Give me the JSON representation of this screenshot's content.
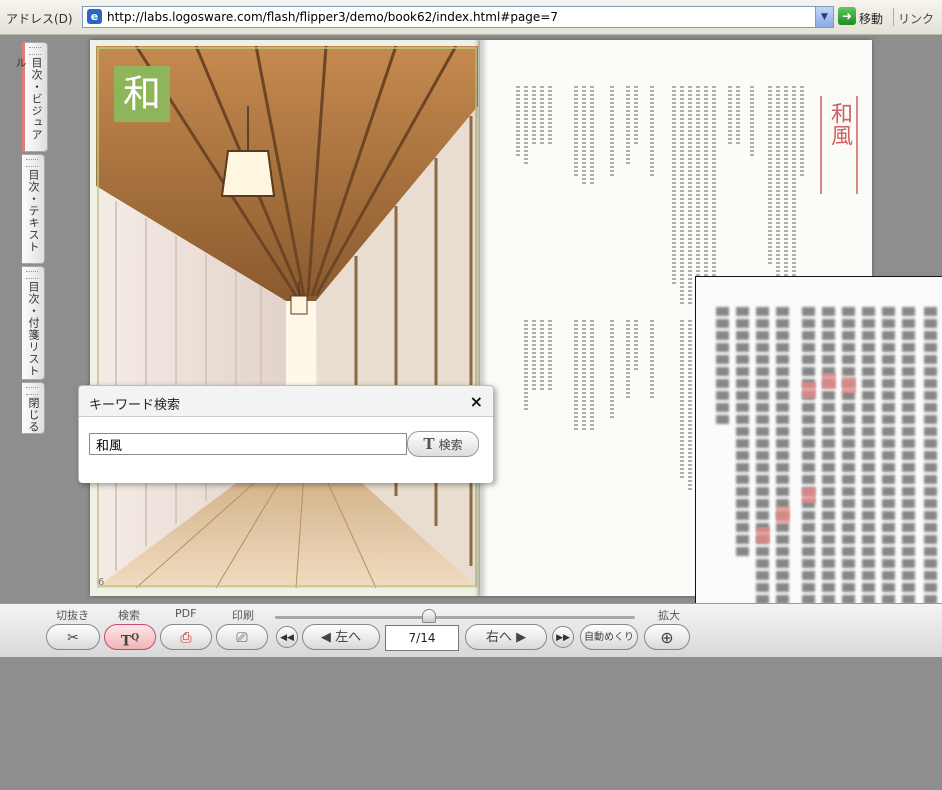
{
  "browser": {
    "address_label": "アドレス(D)",
    "url": "http://labs.logosware.com/flash/flipper3/demo/book62/index.html#page=7",
    "go_label": "移動",
    "links_label": "リンク"
  },
  "side_tabs": [
    {
      "label": "目次・ビジュアル"
    },
    {
      "label": "目次・テキスト"
    },
    {
      "label": "目次・付箋リスト"
    },
    {
      "label": "閉じる"
    }
  ],
  "book": {
    "left_badge": "和",
    "right_heading": "和風",
    "page_number": "6"
  },
  "search_dialog": {
    "title": "キーワード検索",
    "close_icon": "×",
    "query": "和風",
    "search_button": "検索",
    "search_button_icon": "T"
  },
  "toolbar": {
    "labels": {
      "cut": "切抜き",
      "search": "検索",
      "pdf": "PDF",
      "print": "印刷",
      "zoom": "拡大"
    },
    "prev_label": "左へ",
    "next_label": "右へ",
    "page_indicator": "7/14",
    "auto_flip": "自動めくり",
    "icons": {
      "cut": "scissors-icon",
      "search": "text-search-icon",
      "pdf": "pdf-icon",
      "print": "printer-icon",
      "zoom": "zoom-in-icon"
    }
  },
  "accent_colors": {
    "badge_green": "#8fb55a",
    "heading_red": "#d05f5f",
    "active_pink": "#f0b6b6"
  }
}
